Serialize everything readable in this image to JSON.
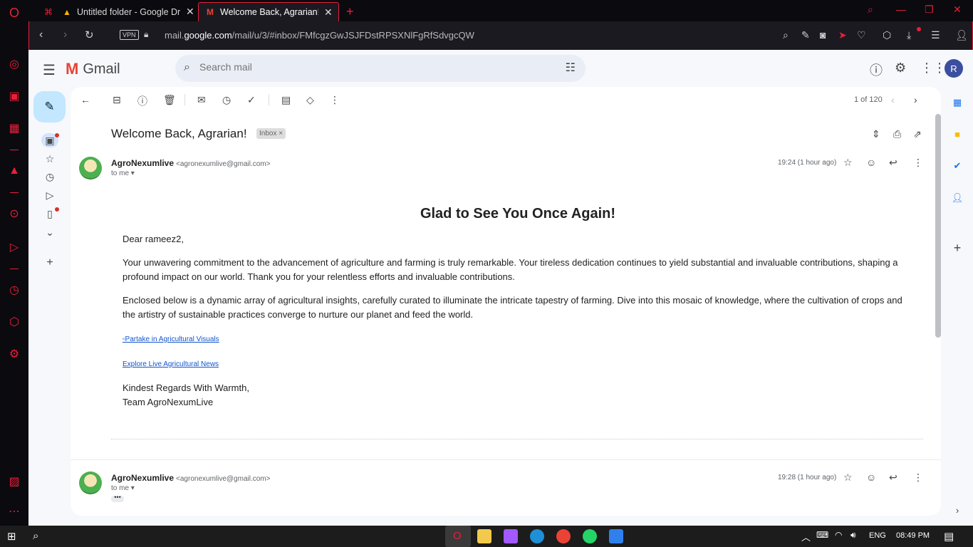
{
  "browser": {
    "tabs": [
      {
        "title": "Untitled folder - Google Dr",
        "icon": "google-drive-icon"
      },
      {
        "title": "Welcome Back, Agrarian! - ",
        "icon": "gmail-icon"
      }
    ],
    "new_tab": "+",
    "vpn_label": "VPN",
    "url_prefix": "mail.",
    "url_domain": "google.com",
    "url_path": "/mail/u/3/#inbox/FMfcgzGwJSJFDstRPSXNlFgRfSdvgcQW"
  },
  "gmail": {
    "brand": "Gmail",
    "search_placeholder": "Search mail",
    "avatar_initial": "R",
    "counter": "1 of 120",
    "subject": "Welcome Back, Agrarian!",
    "label_chip": "Inbox",
    "messages": [
      {
        "sender": "AgroNexumlive",
        "email": "<agronexumlive@gmail.com>",
        "to": "to me",
        "time": "19:24 (1 hour ago)"
      },
      {
        "sender": "AgroNexumlive",
        "email": "<agronexumlive@gmail.com>",
        "to": "to me",
        "time": "19:28 (1 hour ago)"
      }
    ],
    "body": {
      "heading": "Glad to See You Once Again!",
      "greeting": "Dear rameez2,",
      "para1": "Your unwavering commitment to the advancement of agriculture and farming is truly remarkable. Your tireless dedication continues to yield substantial and invaluable contributions, shaping a profound impact on our world. Thank you for your relentless efforts and invaluable contributions.",
      "para2": "Enclosed below is a dynamic array of agricultural insights, carefully curated to illuminate the intricate tapestry of farming. Dive into this mosaic of knowledge, where the cultivation of crops and the artistry of sustainable practices converge to nurture our planet and feed the world.",
      "link1": "Partake in Agricultural Visuals",
      "link2": "Explore Live Agricultural News",
      "signoff1": "Kindest Regards With Warmth,",
      "signoff2": "Team AgroNexumLive"
    }
  },
  "taskbar": {
    "lang": "ENG",
    "time": "08:49 PM"
  },
  "colors": {
    "opera_accent": "#e6203a",
    "gmail_bg": "#f6f8fc",
    "compose_bg": "#c2e7ff",
    "link": "#1155cc"
  }
}
